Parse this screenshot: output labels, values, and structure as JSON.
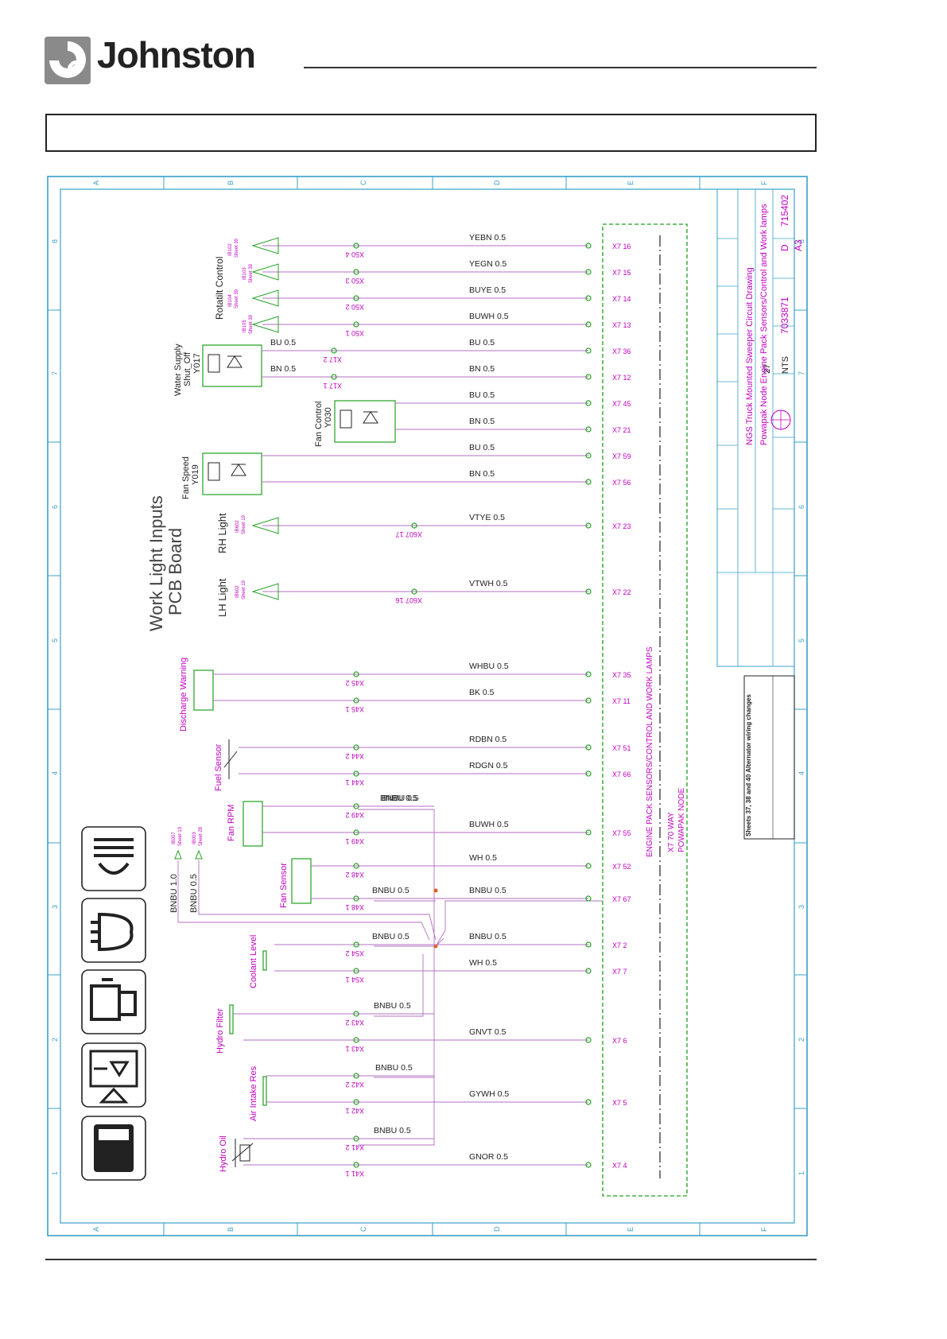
{
  "brand": {
    "name": "Johnston"
  },
  "colors": {
    "frame": "#3aa0c8",
    "magenta": "#c000c0",
    "green": "#20a020",
    "wire": "#b070c0",
    "dark": "#222222"
  },
  "grid": {
    "cols_top": [
      "A",
      "B",
      "C",
      "D",
      "E",
      "F"
    ],
    "rows_left": [
      "8",
      "7",
      "6",
      "5",
      "4",
      "3",
      "2",
      "1"
    ],
    "rows_right": [
      "8",
      "7",
      "6",
      "5",
      "4",
      "3",
      "2",
      "1"
    ]
  },
  "board": {
    "title_line1": "Work Light Inputs",
    "title_line2": "PCB Board"
  },
  "node": {
    "line1": "ENGINE PACK SENSORS/CONTROL AND WORK LAMPS",
    "line2": "X7 70 WAY",
    "line3": "POWAPAK NODE"
  },
  "groups": {
    "rotatilt": "Rotatilt Control",
    "water": [
      "Water Supply",
      "Shut_Off",
      "Y017"
    ],
    "fan_control": [
      "Fan Control",
      "Y030"
    ],
    "fan_speed": [
      "Fan Speed",
      "Y019"
    ],
    "rh_light": "RH Light",
    "lh_light": "LH Light",
    "discharge": "Discharge Warning",
    "fuel": "Fuel Sensor",
    "fan_rpm": "Fan RPM",
    "fan_sensor": "Fan Sensor",
    "coolant": "Coolant Level",
    "hydro_filter": "Hydro Filter",
    "air_intake": "Air Intake Res",
    "hydro_oil": "Hydro Oil"
  },
  "refs": {
    "rot1": [
      "IB102",
      "Sheet 39"
    ],
    "rot2": [
      "IB103",
      "Sheet 39"
    ],
    "rot3": [
      "IB104",
      "Sheet 39"
    ],
    "rot4": [
      "IB105",
      "Sheet 39"
    ],
    "rh": [
      "IB602",
      "Sheet 19"
    ],
    "lh": [
      "IB602",
      "Sheet 19"
    ],
    "b1": [
      "IB007",
      "Sheet 13"
    ],
    "b2": [
      "IB003",
      "Sheet 28"
    ]
  },
  "supply_wires": [
    "BNBU 1.0",
    "BNBU 0.5"
  ],
  "wires": [
    {
      "left": "X50 4",
      "label": "YEBN 0.5",
      "pin": "X7 16"
    },
    {
      "left": "X50 3",
      "label": "YEGN 0.5",
      "pin": "X7 15"
    },
    {
      "left": "X50 2",
      "label": "BUYE 0.5",
      "pin": "X7 14"
    },
    {
      "left": "X50 1",
      "label": "BUWH 0.5",
      "pin": "X7 13"
    },
    {
      "left": "X17 2",
      "label": "BU 0.5",
      "pin": "X7 36",
      "near": "BU 0.5"
    },
    {
      "left": "X17 1",
      "label": "BN 0.5",
      "pin": "X7 12",
      "near": "BN 0.5"
    },
    {
      "left": "",
      "label": "BU 0.5",
      "pin": "X7 45"
    },
    {
      "left": "",
      "label": "BN 0.5",
      "pin": "X7 21"
    },
    {
      "left": "",
      "label": "BU 0.5",
      "pin": "X7 59"
    },
    {
      "left": "",
      "label": "BN 0.5",
      "pin": "X7 56"
    },
    {
      "left": "X607 17",
      "label": "VTYE 0.5",
      "pin": "X7 23"
    },
    {
      "left": "X607 16",
      "label": "VTWH 0.5",
      "pin": "X7 22"
    },
    {
      "left": "X45 2",
      "label": "WHBU 0.5",
      "pin": "X7 35"
    },
    {
      "left": "X45 1",
      "label": "BK 0.5",
      "pin": "X7 11"
    },
    {
      "left": "X44 2",
      "label": "RDBN 0.5",
      "pin": "X7 51"
    },
    {
      "left": "X44 1",
      "label": "RDGN 0.5",
      "pin": "X7 66"
    },
    {
      "left": "X49 2",
      "label": "BNBU 0.5",
      "pin": "",
      "near": "BNBU 0.5"
    },
    {
      "left": "X49 1",
      "label": "BUWH 0.5",
      "pin": "X7 55"
    },
    {
      "left": "X48 2",
      "label": "WH 0.5",
      "pin": "X7 52"
    },
    {
      "left": "X48 1",
      "label": "BNBU 0.5",
      "pin": "X7 67",
      "near": "BNBU 0.5"
    },
    {
      "left": "X54 2",
      "label": "BNBU 0.5",
      "pin": "X7 2",
      "near": "BNBU 0.5"
    },
    {
      "left": "X54 1",
      "label": "WH 0.5",
      "pin": "X7 7"
    },
    {
      "left": "X43 2",
      "label": "",
      "pin": "",
      "near": "BNBU 0.5"
    },
    {
      "left": "X43 1",
      "label": "GNVT 0.5",
      "pin": "X7 6"
    },
    {
      "left": "X42 2",
      "label": "",
      "pin": "",
      "near": "BNBU 0.5"
    },
    {
      "left": "X42 1",
      "label": "GYWH 0.5",
      "pin": "X7 5"
    },
    {
      "left": "X41 2",
      "label": "",
      "pin": "",
      "near": "BNBU 0.5"
    },
    {
      "left": "X41 1",
      "label": "GNOR 0.5",
      "pin": "X7 4"
    }
  ],
  "titleblock": {
    "drawing": "NGS Truck Mounted Sweeper Circuit Drawing",
    "subtitle": "Powapak Node Engine Pack Sensors/Control and Work lamps",
    "number": "7033871",
    "issue": "D",
    "sheet": "27",
    "scale": "NTS",
    "size": "A3",
    "pcn": "715402",
    "revision_note": "Sheets 37, 38 and 40 Alternator wiring changes"
  }
}
